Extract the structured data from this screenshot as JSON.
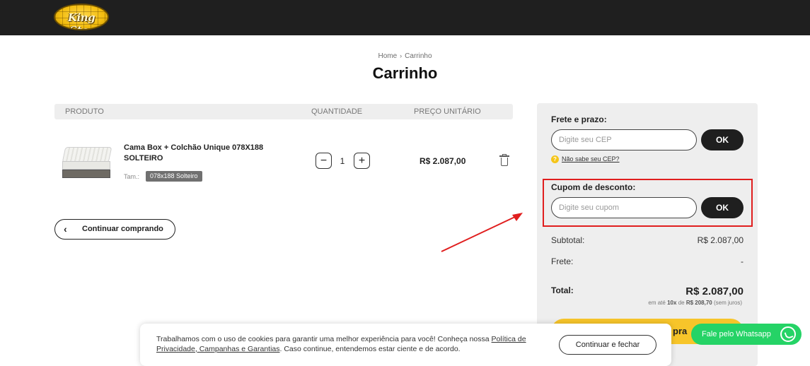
{
  "header": {
    "logo_text": "King Star"
  },
  "breadcrumb": {
    "home": "Home",
    "separator": "›",
    "current": "Carrinho"
  },
  "page_title": "Carrinho",
  "cart_table": {
    "headers": [
      "PRODUTO",
      "QUANTIDADE",
      "PREÇO UNITÁRIO"
    ],
    "items": [
      {
        "name": "Cama Box + Colchão Unique 078X188 SOLTEIRO",
        "size_label": "Tam.:",
        "size_value": "078x188 Solteiro",
        "quantity": "1",
        "qty_minus": "−",
        "qty_plus": "+",
        "unit_price": "R$ 2.087,00"
      }
    ]
  },
  "continue_button": {
    "chevron": "‹",
    "label": "Continuar comprando"
  },
  "summary": {
    "shipping_label": "Frete e prazo:",
    "cep_placeholder": "Digite seu CEP",
    "cep_ok": "OK",
    "cep_help_icon": "?",
    "cep_help": "Não sabe seu CEP?",
    "coupon_label": "Cupom de desconto:",
    "coupon_placeholder": "Digite seu cupom",
    "coupon_ok": "OK",
    "subtotal_label": "Subtotal:",
    "subtotal_value": "R$ 2.087,00",
    "shipping_row_label": "Frete:",
    "shipping_row_value": "-",
    "total_label": "Total:",
    "total_value": "R$ 2.087,00",
    "installments_prefix": "em até",
    "installments_count": "10x",
    "installments_mid": "de",
    "installments_amount": "R$ 208,70",
    "installments_suffix": "(sem juros)",
    "buy_button_visible_text": "pra"
  },
  "cookie_banner": {
    "text_1": "Trabalhamos com o uso de cookies para garantir uma melhor experiência para você! Conheça nossa",
    "policy_link": "Política de Privacidade, Campanhas e Garantias",
    "text_2": ". Caso continue, entendemos estar ciente e de acordo.",
    "button": "Continuar e fechar"
  },
  "whatsapp": {
    "label": "Fale pelo Whatsapp"
  },
  "colors": {
    "header_bg": "#1f1f1f",
    "accent_yellow": "#f7c52a",
    "whatsapp_green": "#25d366",
    "annotation_red": "#e01e1e"
  }
}
